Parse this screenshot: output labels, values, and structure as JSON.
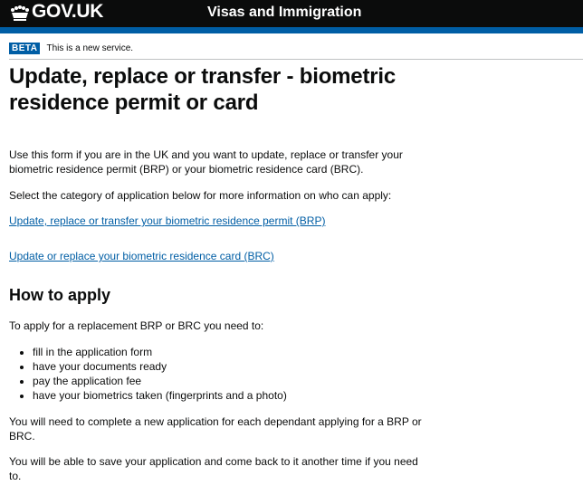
{
  "header": {
    "logo_text": "GOV.UK",
    "service_name": "Visas and Immigration"
  },
  "phase_banner": {
    "tag": "BETA",
    "text": "This is a new service."
  },
  "main": {
    "title": "Update, replace or transfer - biometric residence permit or card",
    "intro": "Use this form if you are in the UK and you want to update, replace or transfer your biometric residence permit (BRP) or your biometric residence card (BRC).",
    "select_category": "Select the category of application below for more information on who can apply:",
    "link_brp": "Update, replace or transfer your biometric residence permit (BRP)",
    "link_brc": "Update or replace your biometric residence card (BRC)",
    "how_to_apply": {
      "heading": "How to apply",
      "lead": "To apply for a replacement BRP or BRC you need to:",
      "steps": [
        "fill in the application form",
        "have your documents ready",
        "pay the application fee",
        "have your biometrics taken (fingerprints and a photo)"
      ],
      "dependants": "You will need to complete a new application for each dependant applying for a BRP or BRC.",
      "save_note": "You will be able to save your application and come back to it another time if you need to."
    }
  },
  "colors": {
    "header_bg": "#0b0c0c",
    "brand_blue": "#005ea5",
    "link": "#005ea5",
    "text": "#0b0c0c"
  }
}
